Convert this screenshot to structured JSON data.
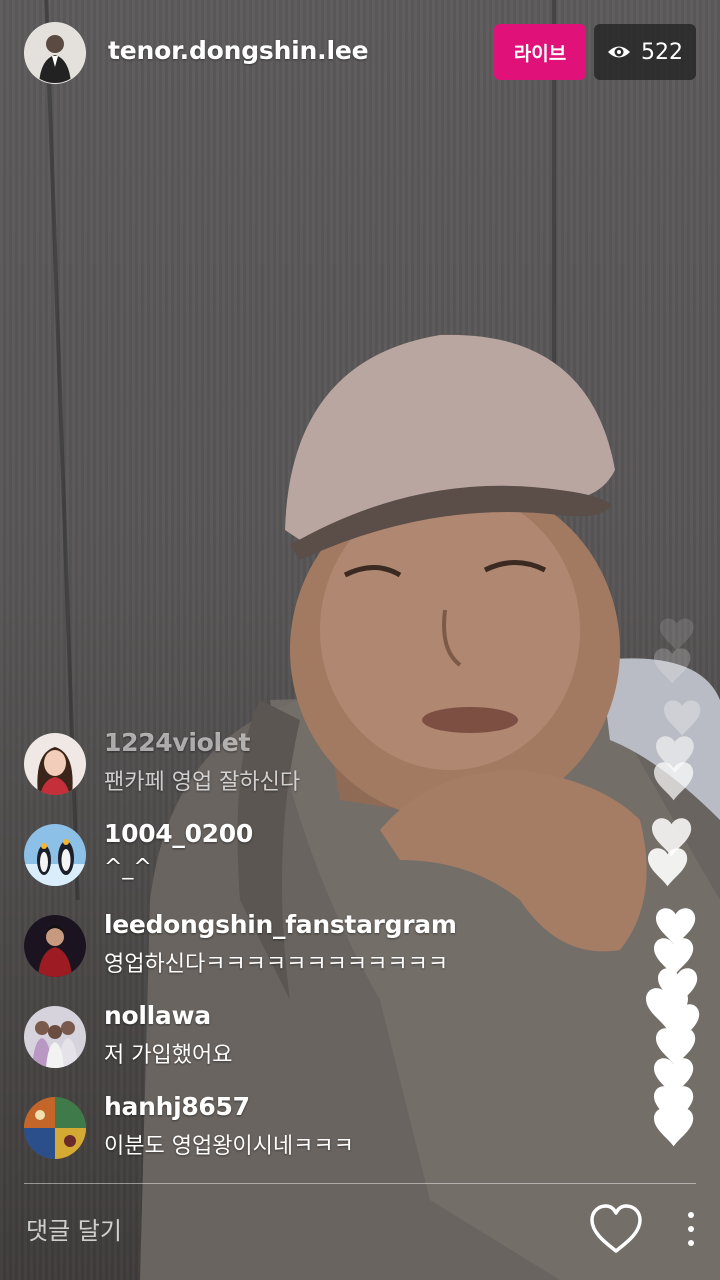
{
  "header": {
    "username": "tenor.dongshin.lee",
    "live_label": "라이브",
    "viewer_count": "522",
    "viewer_icon": "eye-icon"
  },
  "comments": [
    {
      "user": "1224violet",
      "text": "팬카페 영업 잘하신다",
      "faded": true,
      "avatar": "avatar-woman-portrait"
    },
    {
      "user": "1004_0200",
      "text": "^_^",
      "faded": false,
      "avatar": "avatar-penguins"
    },
    {
      "user": "leedongshin_fanstargram",
      "text": "영업하신다ㅋㅋㅋㅋㅋㅋㅋㅋㅋㅋㅋㅋ",
      "faded": false,
      "avatar": "avatar-singer-stage"
    },
    {
      "user": "nollawa",
      "text": "저 가입했어요",
      "faded": false,
      "avatar": "avatar-group-photo"
    },
    {
      "user": "hanhj8657",
      "text": "이분도 영업왕이시네ㅋㅋㅋ",
      "faded": false,
      "avatar": "avatar-colorful-painting"
    }
  ],
  "footer": {
    "comment_placeholder": "댓글 달기",
    "like_icon": "heart-outline-icon",
    "more_icon": "more-vertical-icon"
  },
  "colors": {
    "live_badge": "#e0127a",
    "viewer_badge": "#1e1e1e",
    "text": "#ffffff"
  }
}
